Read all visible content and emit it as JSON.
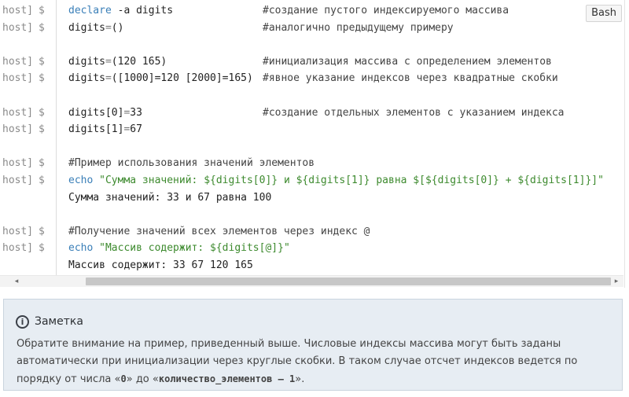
{
  "code_block": {
    "language": "Bash",
    "prompt_host": "host]",
    "prompt_dollar": "$",
    "lines": [
      {
        "type": "cmd",
        "kw": "declare",
        "rest": " -a digits",
        "comment": "#создание пустого индексируемого массива"
      },
      {
        "type": "cmd",
        "lhs": "digits",
        "op": "=",
        "rest": "()",
        "comment": "#аналогично предыдущему примеру"
      },
      {
        "type": "blank"
      },
      {
        "type": "cmd",
        "lhs": "digits",
        "op": "=",
        "rest": "(120 165)",
        "comment": "#инициализация массива с определением элементов"
      },
      {
        "type": "cmd",
        "lhs": "digits",
        "op": "=",
        "rest": "([1000]=120 [2000]=165)",
        "comment": "#явное указание индексов через квадратные скобки"
      },
      {
        "type": "blank"
      },
      {
        "type": "cmd",
        "lhs": "digits[0]",
        "op": "=",
        "rest": "33",
        "comment": "#создание отдельных элементов с указанием индекса"
      },
      {
        "type": "cmd",
        "lhs": "digits[1]",
        "op": "=",
        "rest": "67"
      },
      {
        "type": "blank"
      },
      {
        "type": "comment_only",
        "comment": "#Пример использования значений элементов"
      },
      {
        "type": "echo",
        "kw": "echo",
        "str": " \"Сумма значений: ${digits[0]} и ${digits[1]} равна $[${digits[0]} + ${digits[1]}]\""
      },
      {
        "type": "output",
        "text": "Сумма значений: 33 и 67 равна 100"
      },
      {
        "type": "blank"
      },
      {
        "type": "comment_only",
        "comment": "#Получение значений всех элементов через индекс @"
      },
      {
        "type": "echo",
        "kw": "echo",
        "str": " \"Массив содержит: ${digits[@]}\""
      },
      {
        "type": "output",
        "text": "Массив содержит: 33 67 120 165"
      }
    ]
  },
  "scrollbar": {
    "left_arrow": "◂",
    "right_arrow": "▸"
  },
  "note": {
    "icon": "i",
    "title": "Заметка",
    "body_1": "Обратите внимание на пример, приведенный выше. Числовые индексы массива могут быть заданы автоматически при инициализации через круглые скобки. В таком случае отсчет индексов ведется по порядку от числа «",
    "code_1": "0",
    "body_2": "» до «",
    "code_2": "количество_элементов – 1",
    "body_3": "»."
  }
}
